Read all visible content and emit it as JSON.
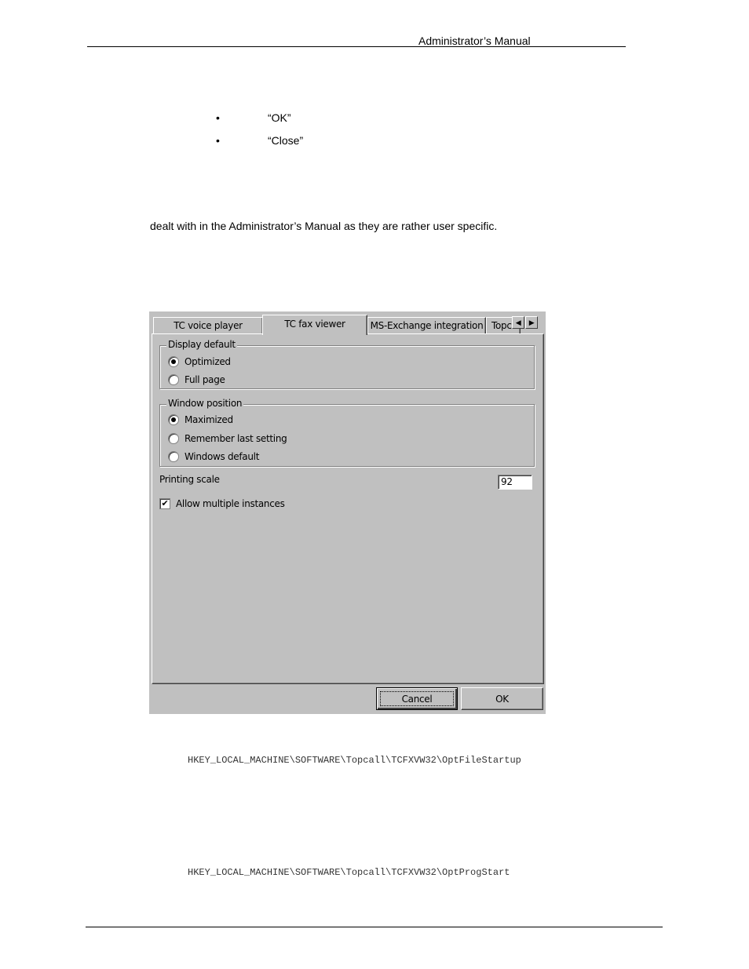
{
  "header": {
    "title": "Administrator’s Manual"
  },
  "bullets": [
    {
      "marker": "•",
      "text": "“OK”"
    },
    {
      "marker": "•",
      "text": "“Close”"
    }
  ],
  "paragraph": "dealt with in the Administrator’s Manual as they are rather user specific.",
  "dialog": {
    "tabs": [
      {
        "label": "TC voice player",
        "active": false
      },
      {
        "label": "TC  fax viewer",
        "active": true
      },
      {
        "label": "MS-Exchange integration",
        "active": false
      },
      {
        "label": "Topc",
        "active": false
      }
    ],
    "tab_scroll_left": "◀",
    "tab_scroll_right": "▶",
    "display_default": {
      "legend": "Display default",
      "options": [
        {
          "label": "Optimized",
          "selected": true
        },
        {
          "label": "Full page",
          "selected": false
        }
      ]
    },
    "window_position": {
      "legend": "Window position",
      "options": [
        {
          "label": "Maximized",
          "selected": true
        },
        {
          "label": "Remember last setting",
          "selected": false
        },
        {
          "label": "Windows default",
          "selected": false
        }
      ]
    },
    "printing_scale": {
      "label": "Printing scale",
      "value": "92"
    },
    "allow_multiple": {
      "label": "Allow multiple instances",
      "checked": true,
      "mark": "✔"
    },
    "buttons": {
      "cancel": "Cancel",
      "ok": "OK"
    }
  },
  "registry_keys": [
    "HKEY_LOCAL_MACHINE\\SOFTWARE\\Topcall\\TCFXVW32\\OptFileStartup",
    "HKEY_LOCAL_MACHINE\\SOFTWARE\\Topcall\\TCFXVW32\\OptProgStart"
  ]
}
